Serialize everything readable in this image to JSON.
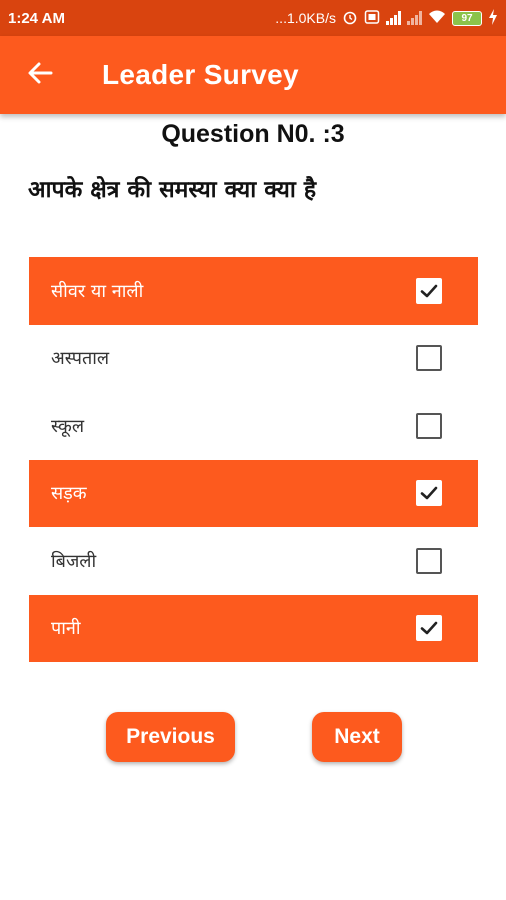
{
  "status_bar": {
    "time": "1:24 AM",
    "network_speed": "...1.0KB/s",
    "battery": "97"
  },
  "app_bar": {
    "title": "Leader Survey",
    "back_icon": "arrow-left-icon"
  },
  "question": {
    "number_label": "Question N0. :3",
    "text": "आपके क्षेत्र की समस्या क्या क्या  है"
  },
  "options": [
    {
      "label": "सीवर या नाली",
      "checked": true
    },
    {
      "label": "अस्पताल",
      "checked": false
    },
    {
      "label": "स्कूल",
      "checked": false
    },
    {
      "label": "सड़क",
      "checked": true
    },
    {
      "label": "बिजली",
      "checked": false
    },
    {
      "label": "पानी",
      "checked": true
    }
  ],
  "buttons": {
    "previous": "Previous",
    "next": "Next"
  },
  "colors": {
    "accent": "#fd5a1e",
    "status_bar": "#d9440f"
  }
}
